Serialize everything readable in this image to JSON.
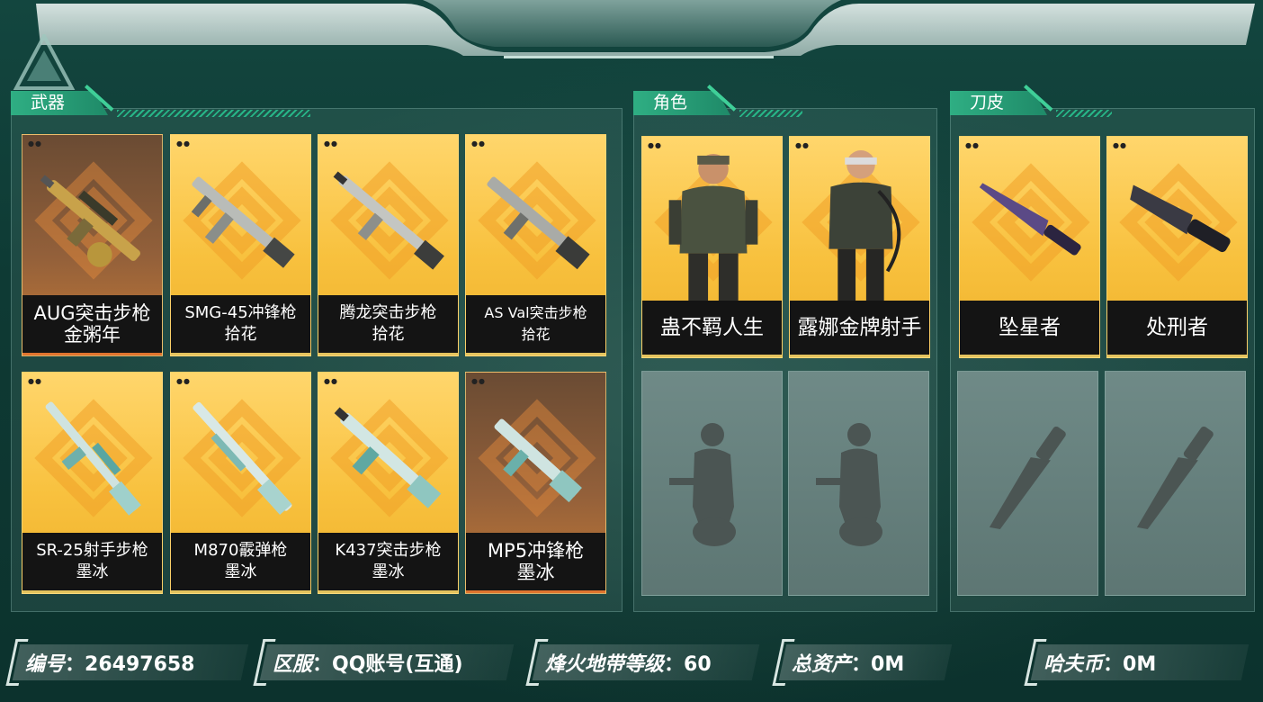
{
  "sections": {
    "weapons": {
      "title": "武器"
    },
    "characters": {
      "title": "角色"
    },
    "knives": {
      "title": "刀皮"
    }
  },
  "weapons": [
    {
      "name": "AUG突击步枪",
      "skin": "金粥年",
      "rarity": "brown"
    },
    {
      "name": "SMG-45冲锋枪",
      "skin": "拾花",
      "rarity": "gold"
    },
    {
      "name": "腾龙突击步枪",
      "skin": "拾花",
      "rarity": "gold"
    },
    {
      "name": "AS Val突击步枪",
      "skin": "拾花",
      "rarity": "gold"
    },
    {
      "name": "SR-25射手步枪",
      "skin": "墨冰",
      "rarity": "gold"
    },
    {
      "name": "M870霰弹枪",
      "skin": "墨冰",
      "rarity": "gold"
    },
    {
      "name": "K437突击步枪",
      "skin": "墨冰",
      "rarity": "gold"
    },
    {
      "name": "MP5冲锋枪",
      "skin": "墨冰",
      "rarity": "brown"
    }
  ],
  "characters": [
    {
      "name": "蛊不羁人生"
    },
    {
      "name": "露娜金牌射手"
    }
  ],
  "knives": [
    {
      "name": "坠星者"
    },
    {
      "name": "处刑者"
    }
  ],
  "info": {
    "id_key": "编号",
    "id_val": "26497658",
    "server_key": "区服",
    "server_val": "QQ账号(互通)",
    "level_key": "烽火地带等级",
    "level_val": "60",
    "assets_key": "总资产",
    "assets_val": "0M",
    "coin_key": "哈夫币",
    "coin_val": "0M"
  }
}
